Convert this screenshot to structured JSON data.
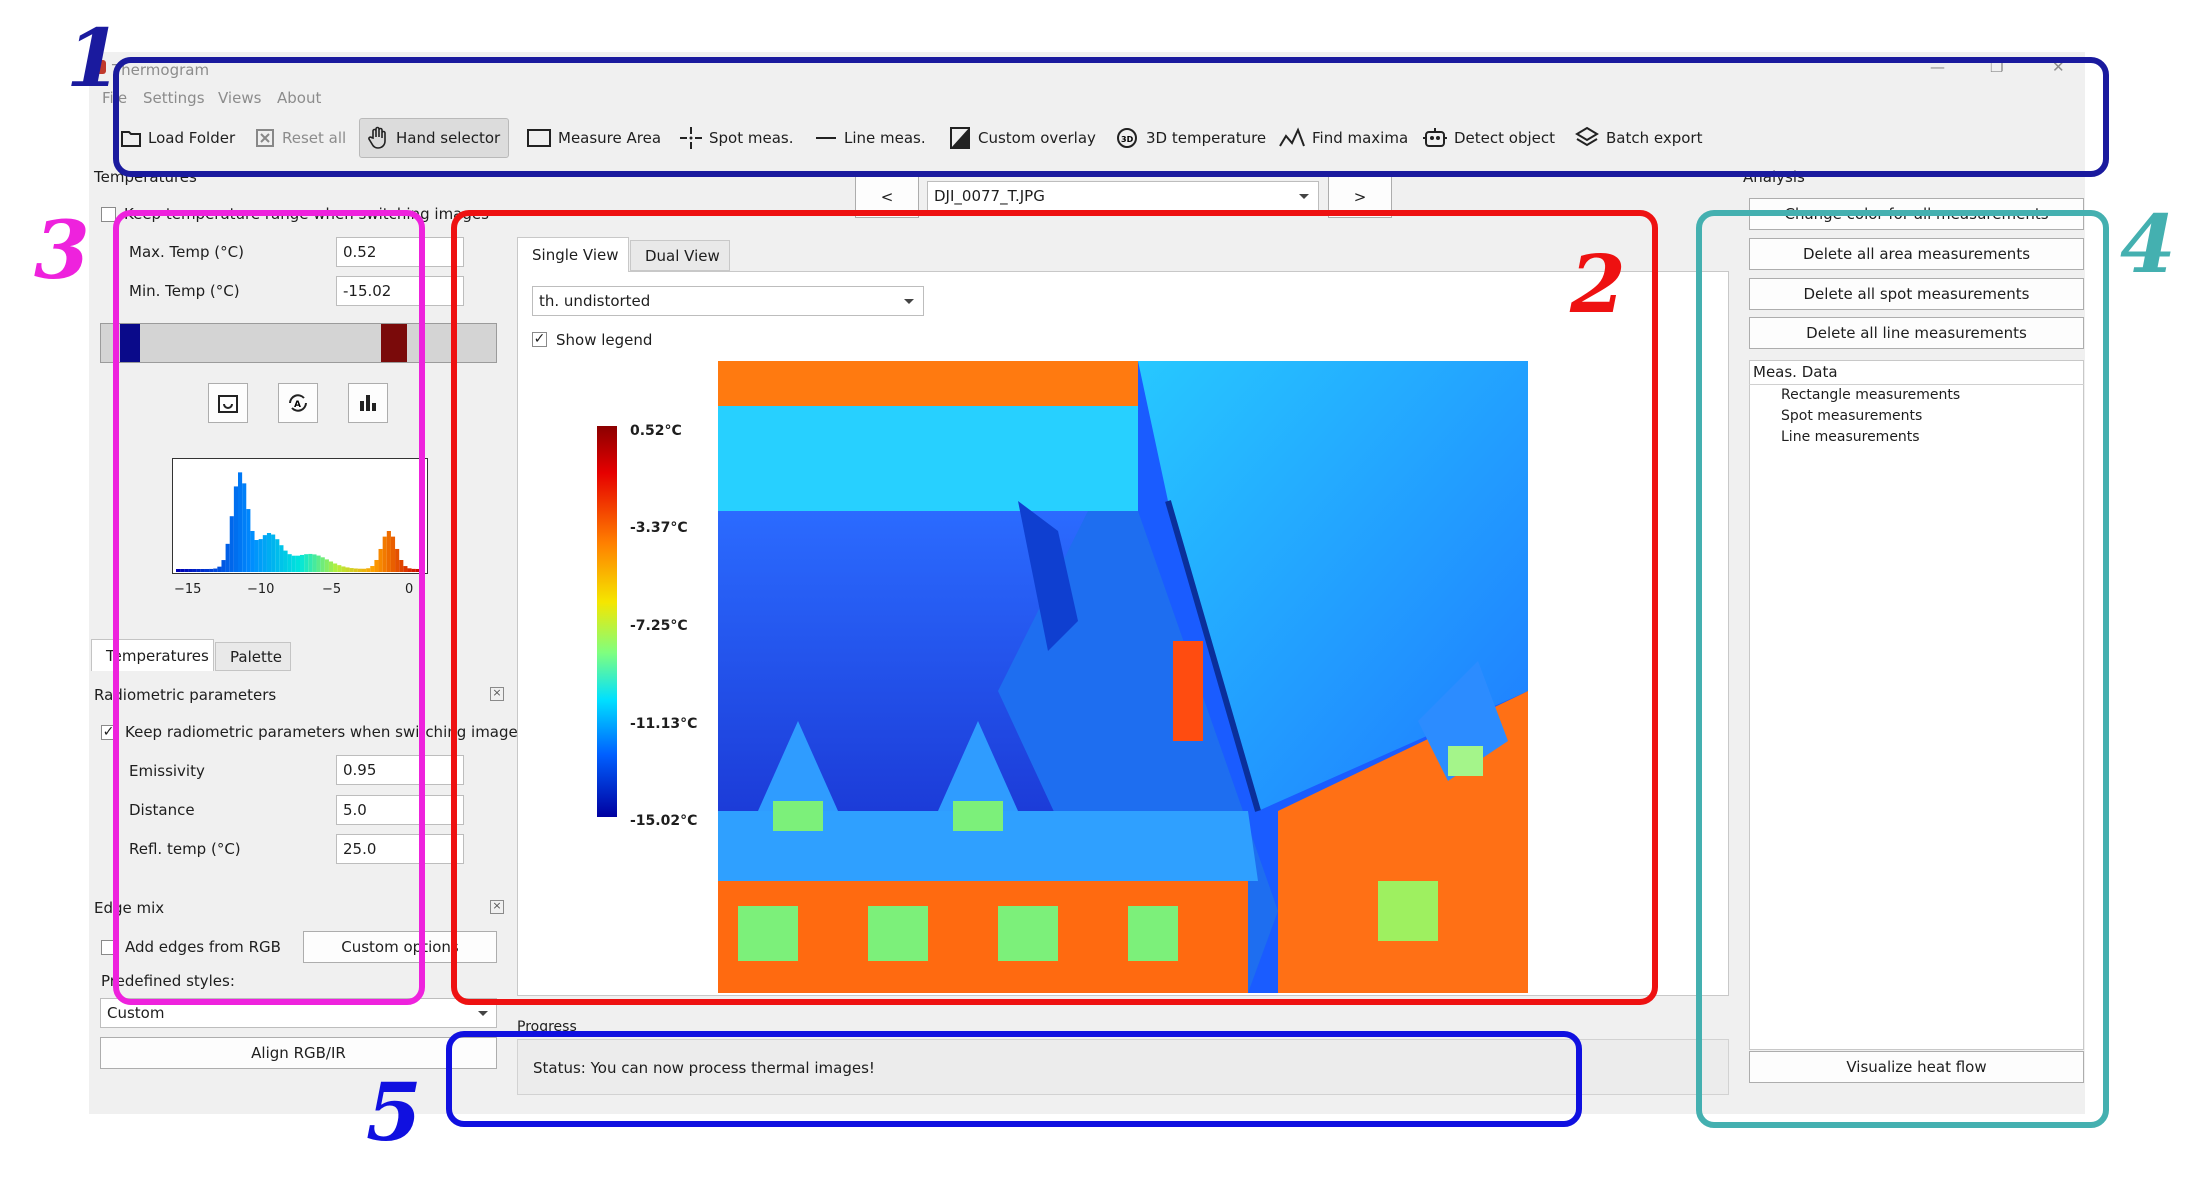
{
  "window": {
    "title": "Thermogram",
    "controls": [
      "—",
      "❐",
      "✕"
    ],
    "menu": [
      "File",
      "Settings",
      "Views",
      "About"
    ]
  },
  "toolbar": {
    "load_folder": "Load Folder",
    "reset_all": "Reset all",
    "hand_selector": "Hand selector",
    "measure_area": "Measure Area",
    "spot_meas": "Spot meas.",
    "line_meas": "Line meas.",
    "custom_overlay": "Custom overlay",
    "temperature_3d": "3D temperature",
    "find_maxima": "Find maxima",
    "detect_object": "Detect object",
    "batch_export": "Batch export"
  },
  "nav": {
    "prev": "<",
    "next": ">",
    "file_selected": "DJI_0077_T.JPG"
  },
  "left": {
    "section_title": "Temperatures",
    "keep_range_label": "Keep temperature range when switching images",
    "max_temp_label": "Max. Temp (°C)",
    "max_temp_value": "0.52",
    "min_temp_label": "Min. Temp (°C)",
    "min_temp_value": "-15.02",
    "histogram_ticks": [
      "−15",
      "−10",
      "−5",
      "0"
    ],
    "tabs": [
      "Temperatures",
      "Palette"
    ],
    "radiometric_title": "Radiometric parameters",
    "keep_radiometric_label": "Keep radiometric parameters when switching images",
    "emissivity_label": "Emissivity",
    "emissivity_value": "0.95",
    "distance_label": "Distance",
    "distance_value": "5.0",
    "refl_temp_label": "Refl. temp (°C)",
    "refl_temp_value": "25.0",
    "edge_mix_title": "Edge mix",
    "add_edges_label": "Add edges from RGB",
    "custom_options_label": "Custom options",
    "predefined_label": "Predefined styles:",
    "predefined_value": "Custom",
    "align_label": "Align RGB/IR"
  },
  "viewer": {
    "tabs": [
      "Single View",
      "Dual View"
    ],
    "view_mode": "th. undistorted",
    "show_legend_label": "Show legend",
    "legend_labels": [
      "0.52°C",
      "-3.37°C",
      "-7.25°C",
      "-11.13°C",
      "-15.02°C"
    ]
  },
  "progress": {
    "title": "Progress",
    "status": "Status: You can now process thermal images!"
  },
  "analysis": {
    "title": "Analysis",
    "change_color": "Change color for all measurements",
    "delete_area": "Delete all area measurements",
    "delete_spot": "Delete all spot measurements",
    "delete_line": "Delete all line measurements",
    "meas_header": "Meas. Data",
    "meas_items": [
      "Rectangle measurements",
      "Spot measurements",
      "Line measurements"
    ],
    "visualize": "Visualize heat flow"
  },
  "annotations": {
    "labels": [
      "1",
      "2",
      "3",
      "4",
      "5"
    ],
    "colors": {
      "toolbar": "#1a1a9e",
      "viewer": "#ee1111",
      "temperatures": "#ee22dd",
      "analysis": "#44b0b0",
      "status": "#1010e0"
    }
  },
  "colors": {
    "window_bg": "#f0f0f0",
    "accent_selected": "#dcdcdc",
    "palette_min": "#0000a0",
    "palette_max": "#a00000"
  }
}
